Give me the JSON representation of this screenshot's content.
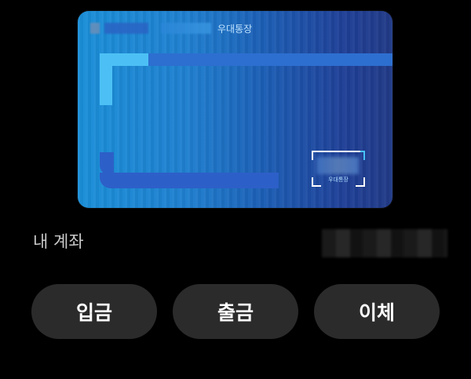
{
  "card": {
    "account_type": "우대통장",
    "mini_label": "우대통장"
  },
  "account": {
    "label": "내 계좌"
  },
  "actions": {
    "deposit": "입금",
    "withdraw": "출금",
    "transfer": "이체"
  }
}
